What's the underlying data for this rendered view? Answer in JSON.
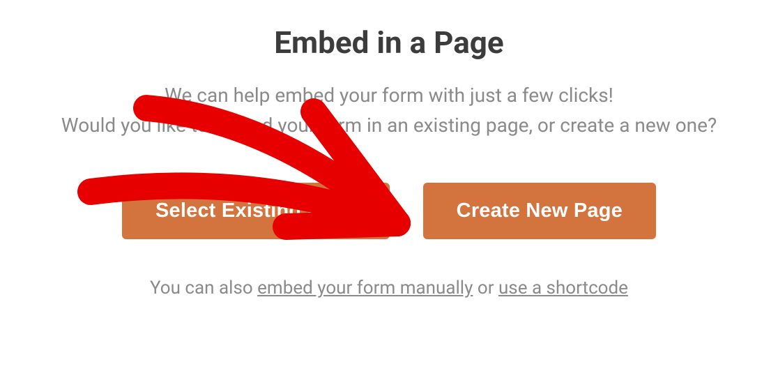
{
  "modal": {
    "title": "Embed in a Page",
    "subtitle_line1": "We can help embed your form with just a few clicks!",
    "subtitle_line2": "Would you like to embed your form in an existing page, or create a new one?",
    "buttons": {
      "select_existing": "Select Existing Page",
      "create_new": "Create New Page"
    },
    "footer": {
      "prefix": "You can also ",
      "link_manual": "embed your form manually",
      "mid": " or ",
      "link_shortcode": "use a shortcode"
    }
  },
  "annotation": {
    "arrow_color": "#e60000"
  }
}
